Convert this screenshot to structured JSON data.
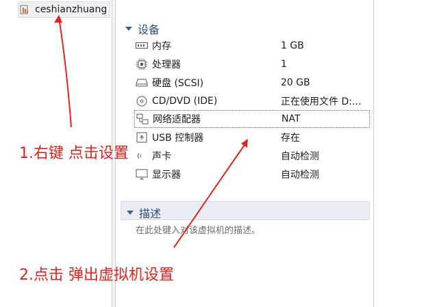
{
  "library": {
    "vm_name": "ceshianzhuang"
  },
  "devices_section": {
    "title": "设备"
  },
  "devices": [
    {
      "icon": "memory-icon",
      "name": "内存",
      "value": "1 GB"
    },
    {
      "icon": "processor-icon",
      "name": "处理器",
      "value": "1"
    },
    {
      "icon": "hard-disk-icon",
      "name": "硬盘 (SCSI)",
      "value": "20 GB"
    },
    {
      "icon": "cd-dvd-icon",
      "name": "CD/DVD (IDE)",
      "value": "正在使用文件 D:..."
    },
    {
      "icon": "network-adapter-icon",
      "name": "网络适配器",
      "value": "NAT"
    },
    {
      "icon": "usb-icon",
      "name": "USB 控制器",
      "value": "存在"
    },
    {
      "icon": "sound-card-icon",
      "name": "声卡",
      "value": "自动检测"
    },
    {
      "icon": "display-icon",
      "name": "显示器",
      "value": "自动检测"
    }
  ],
  "description_section": {
    "title": "描述",
    "placeholder": "在此处键入对该虚拟机的描述。"
  },
  "annotations": {
    "step1": "1.右键 点击设置",
    "step2": "2.点击 弹出虚拟机设置"
  },
  "colors": {
    "annotation": "#e8201a",
    "section_title": "#2d4f7c"
  }
}
